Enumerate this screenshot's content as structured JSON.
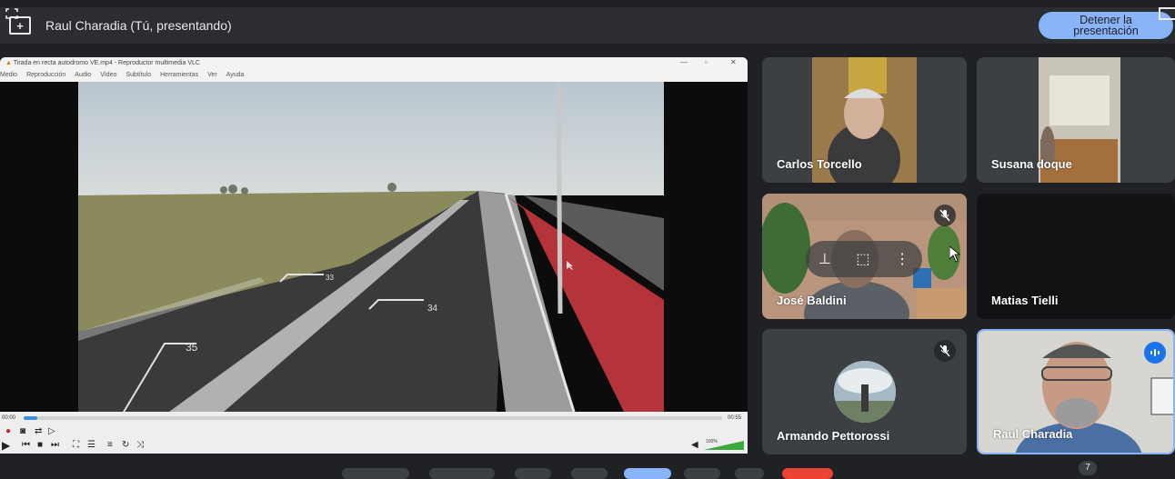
{
  "header": {
    "presenter_title": "Raul Charadia (Tú, presentando)",
    "stop_button_label": "Detener la presentación",
    "stop_button_color": "#8ab4f8"
  },
  "vlc": {
    "window_title": "Tirada en recta autodromo VE.mp4 - Reproductor multimedia VLC",
    "menu": [
      "Medio",
      "Reproducción",
      "Audio",
      "Vídeo",
      "Subtítulo",
      "Herramientas",
      "Ver",
      "Ayuda"
    ],
    "elapsed": "00:00",
    "duration": "00:55",
    "progress": 0.02,
    "volume": "100%",
    "track_numbers": [
      "35",
      "34",
      "33"
    ]
  },
  "participants": [
    {
      "name": "Carlos Torcello",
      "muted": false
    },
    {
      "name": "Susana doque",
      "muted": false
    },
    {
      "name": "José Baldini",
      "muted": true
    },
    {
      "name": "Matias Tielli",
      "muted": false
    },
    {
      "name": "Armando Pettorossi",
      "muted": true
    },
    {
      "name": "Raul Charadia",
      "muted": false,
      "speaking": true
    }
  ],
  "toolbar": {
    "participant_count": "7"
  },
  "colors": {
    "background": "#202124",
    "tile": "#3c4043",
    "accent": "#1a73e8"
  }
}
